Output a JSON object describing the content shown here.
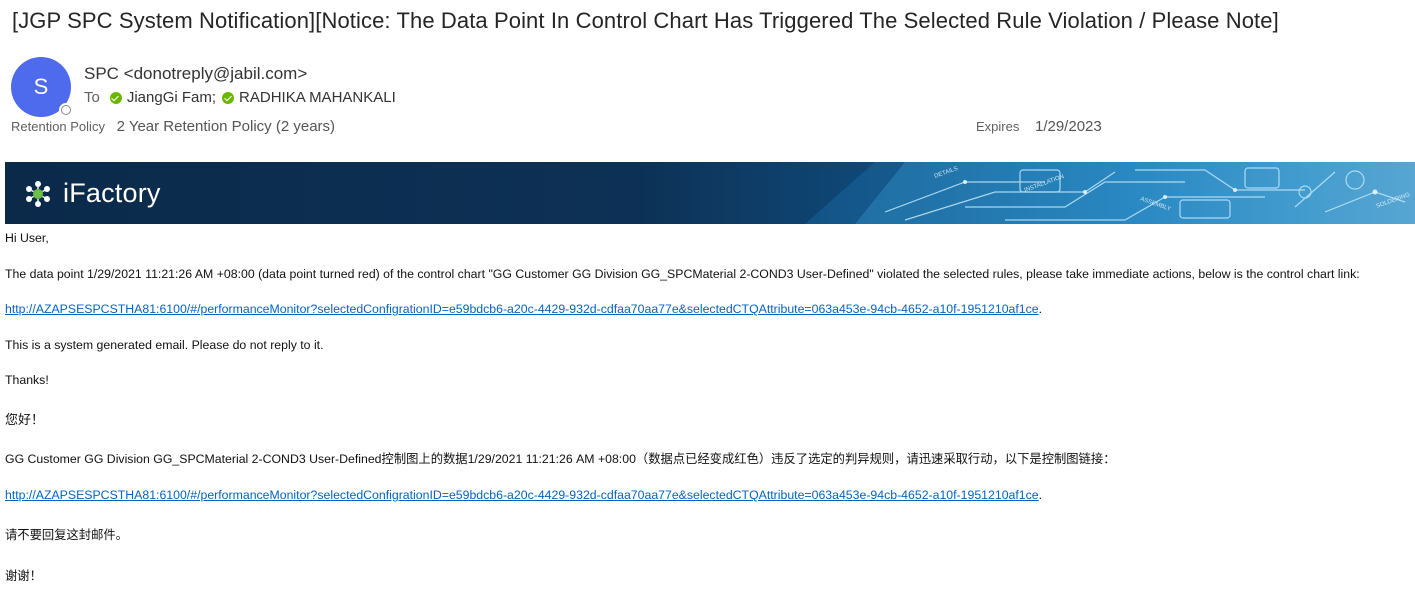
{
  "email": {
    "subject": "[JGP SPC System Notification][Notice: The Data Point In Control Chart Has Triggered The Selected Rule Violation / Please Note]",
    "avatar_initial": "S",
    "sender": "SPC <donotreply@jabil.com>",
    "to_label": "To",
    "recipients": [
      "JiangGi Fam;",
      "RADHIKA MAHANKALI"
    ],
    "retention_label": "Retention Policy",
    "retention_value": "2 Year Retention Policy (2 years)",
    "expires_label": "Expires",
    "expires_value": "1/29/2023"
  },
  "banner": {
    "brand": "iFactory",
    "overlay_words": [
      "DETAILS",
      "INSTALLATION",
      "ASSEMBLY",
      "SOLDERING"
    ]
  },
  "body": {
    "greeting_en": "Hi User,",
    "message_en": "The data point 1/29/2021 11:21:26 AM +08:00 (data point turned red) of the control chart \"GG Customer GG Division GG_SPCMaterial 2-COND3 User-Defined\" violated the selected rules, please take immediate actions, below is the control chart link:",
    "link": "http://AZAPSESPCSTHA81:6100/#/performanceMonitor?selectedConfigrationID=e59bdcb6-a20c-4429-932d-cdfaa70aa77e&selectedCTQAttribute=063a453e-94cb-4652-a10f-1951210af1ce",
    "link_suffix": ".",
    "system_note_en": "This is a system generated email. Please do not reply to it.",
    "thanks_en": "Thanks!",
    "greeting_cn": "您好！",
    "message_cn": "GG Customer GG Division GG_SPCMaterial 2-COND3 User-Defined控制图上的数据1/29/2021 11:21:26 AM +08:00（数据点已经变成红色）违反了选定的判异规则，请迅速采取行动，以下是控制图链接：",
    "system_note_cn": "请不要回复这封邮件。",
    "thanks_cn": "谢谢！"
  },
  "colors": {
    "avatar": "#4f6bed",
    "link": "#0563c1",
    "presence_ok": "#6bb700",
    "banner_dark": "#0b2a4a"
  }
}
